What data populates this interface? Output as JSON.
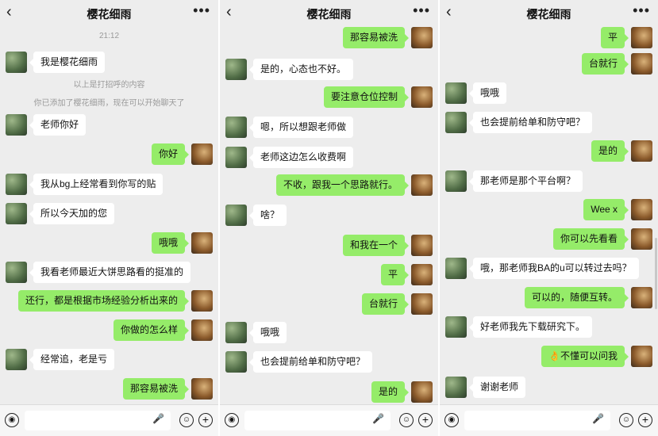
{
  "panels": [
    {
      "title": "樱花细雨",
      "items": [
        {
          "kind": "sys",
          "text": "21:12"
        },
        {
          "kind": "in",
          "text": "我是樱花细雨"
        },
        {
          "kind": "sys",
          "text": "以上是打招呼的内容"
        },
        {
          "kind": "sys",
          "text": "你已添加了樱花细雨，现在可以开始聊天了"
        },
        {
          "kind": "in",
          "text": "老师你好"
        },
        {
          "kind": "out",
          "text": "你好"
        },
        {
          "kind": "in",
          "text": "我从bg上经常看到你写的贴"
        },
        {
          "kind": "in",
          "text": "所以今天加的您"
        },
        {
          "kind": "out",
          "text": "哦哦"
        },
        {
          "kind": "in",
          "text": "我看老师最近大饼思路看的挺准的"
        },
        {
          "kind": "out",
          "text": "还行，都是根据市场经验分析出来的"
        },
        {
          "kind": "out",
          "text": "你做的怎么样"
        },
        {
          "kind": "in",
          "text": "经常追，老是亏"
        },
        {
          "kind": "out",
          "text": "那容易被洗"
        }
      ]
    },
    {
      "title": "樱花细雨",
      "items": [
        {
          "kind": "out",
          "text": "那容易被洗"
        },
        {
          "kind": "in",
          "text": "是的，心态也不好。"
        },
        {
          "kind": "out",
          "text": "要注意仓位控制"
        },
        {
          "kind": "in",
          "text": "嗯，所以想跟老师做"
        },
        {
          "kind": "in",
          "text": "老师这边怎么收费啊"
        },
        {
          "kind": "out",
          "text": "不收，跟我一个思路就行。"
        },
        {
          "kind": "in",
          "text": "啥？"
        },
        {
          "kind": "out",
          "text": "和我在一个"
        },
        {
          "kind": "out",
          "text": "平"
        },
        {
          "kind": "out",
          "text": "台就行"
        },
        {
          "kind": "in",
          "text": "哦哦"
        },
        {
          "kind": "in",
          "text": "也会提前给单和防守吧？"
        },
        {
          "kind": "out",
          "text": "是的"
        }
      ]
    },
    {
      "title": "樱花细雨",
      "items": [
        {
          "kind": "out",
          "text": "平"
        },
        {
          "kind": "out",
          "text": "台就行"
        },
        {
          "kind": "in",
          "text": "哦哦"
        },
        {
          "kind": "in",
          "text": "也会提前给单和防守吧？"
        },
        {
          "kind": "out",
          "text": "是的"
        },
        {
          "kind": "in",
          "text": "那老师是那个平台啊？"
        },
        {
          "kind": "out",
          "text": "Wee x"
        },
        {
          "kind": "out",
          "text": "你可以先看看"
        },
        {
          "kind": "in",
          "text": "哦，那老师我BA的u可以转过去吗？"
        },
        {
          "kind": "out",
          "text": "可以的，随便互转。"
        },
        {
          "kind": "in",
          "text": "好老师我先下载研究下。"
        },
        {
          "kind": "out",
          "text": "👌不懂可以问我"
        },
        {
          "kind": "in",
          "text": "谢谢老师"
        }
      ]
    }
  ],
  "icons": {
    "back": "‹",
    "more": "•••",
    "voice": "voice-icon",
    "mic": "mic-icon",
    "emoji": "emoji-icon",
    "plus": "plus-icon"
  },
  "colors": {
    "background": "#ededed",
    "outgoing_bubble": "#95ec69",
    "incoming_bubble": "#ffffff"
  }
}
